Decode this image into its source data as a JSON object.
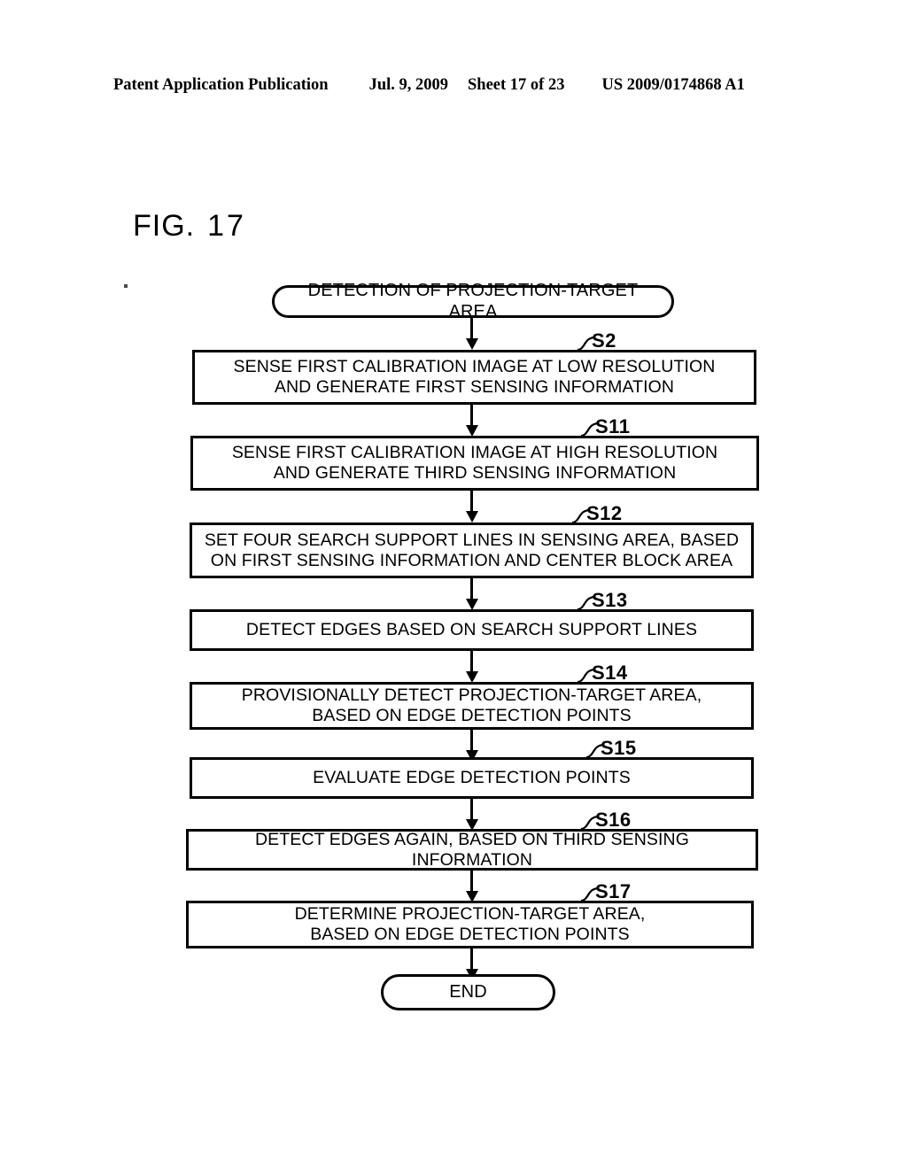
{
  "header": {
    "publication": "Patent Application Publication",
    "date": "Jul. 9, 2009",
    "sheet": "Sheet 17 of 23",
    "patent_number": "US 2009/0174868 A1"
  },
  "figure": {
    "label_prefix": "FIG.",
    "label_number": "17"
  },
  "flowchart": {
    "start": {
      "text": "DETECTION OF PROJECTION-TARGET AREA"
    },
    "end": {
      "text": "END"
    },
    "steps": [
      {
        "id": "S2",
        "text": "SENSE FIRST CALIBRATION IMAGE AT LOW RESOLUTION\nAND GENERATE FIRST SENSING INFORMATION"
      },
      {
        "id": "S11",
        "text": "SENSE FIRST CALIBRATION IMAGE AT HIGH RESOLUTION\nAND GENERATE THIRD SENSING INFORMATION"
      },
      {
        "id": "S12",
        "text": "SET FOUR SEARCH SUPPORT LINES IN SENSING AREA, BASED\nON FIRST SENSING INFORMATION AND CENTER BLOCK AREA"
      },
      {
        "id": "S13",
        "text": "DETECT EDGES BASED ON SEARCH SUPPORT LINES"
      },
      {
        "id": "S14",
        "text": "PROVISIONALLY DETECT PROJECTION-TARGET AREA,\nBASED ON EDGE DETECTION POINTS"
      },
      {
        "id": "S15",
        "text": "EVALUATE EDGE DETECTION POINTS"
      },
      {
        "id": "S16",
        "text": "DETECT EDGES AGAIN, BASED ON THIRD SENSING INFORMATION"
      },
      {
        "id": "S17",
        "text": "DETERMINE PROJECTION-TARGET AREA,\nBASED ON EDGE DETECTION POINTS"
      }
    ]
  }
}
